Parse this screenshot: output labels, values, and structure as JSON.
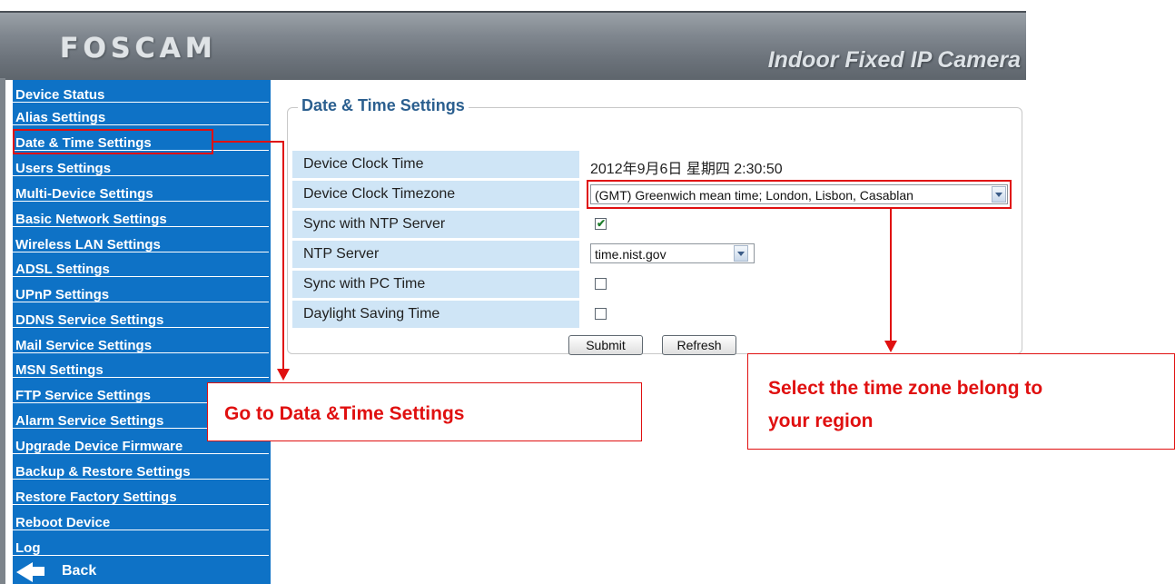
{
  "header": {
    "logo": "FOSCAM",
    "product": "Indoor Fixed IP Camera"
  },
  "sidebar": {
    "items": [
      {
        "label": "Device Status"
      },
      {
        "label": "Alias Settings"
      },
      {
        "label": "Date & Time Settings"
      },
      {
        "label": "Users Settings"
      },
      {
        "label": "Multi-Device Settings"
      },
      {
        "label": "Basic Network Settings"
      },
      {
        "label": "Wireless LAN Settings"
      },
      {
        "label": "ADSL Settings"
      },
      {
        "label": "UPnP Settings"
      },
      {
        "label": "DDNS Service Settings"
      },
      {
        "label": "Mail Service Settings"
      },
      {
        "label": "MSN Settings"
      },
      {
        "label": "FTP Service Settings"
      },
      {
        "label": "Alarm Service Settings"
      },
      {
        "label": "Upgrade Device Firmware"
      },
      {
        "label": "Backup & Restore Settings"
      },
      {
        "label": "Restore Factory Settings"
      },
      {
        "label": "Reboot Device"
      },
      {
        "label": "Log"
      }
    ],
    "back_label": "Back",
    "back_icon": "back-arrow-icon"
  },
  "panel": {
    "title": "Date & Time Settings",
    "rows": {
      "clock_time": {
        "label": "Device Clock Time",
        "value": "2012年9月6日 星期四 2:30:50"
      },
      "timezone": {
        "label": "Device Clock Timezone",
        "value": "(GMT) Greenwich mean time; London, Lisbon, Casablan"
      },
      "sync_ntp": {
        "label": "Sync with NTP Server",
        "checked": true
      },
      "ntp_server": {
        "label": "NTP Server",
        "value": "time.nist.gov"
      },
      "sync_pc": {
        "label": "Sync with PC Time",
        "checked": false
      },
      "dst": {
        "label": "Daylight Saving Time",
        "checked": false
      }
    },
    "submit_label": "Submit",
    "refresh_label": "Refresh"
  },
  "annotations": {
    "left_callout": "Go to Data &Time Settings",
    "right_callout_line1": "Select the time zone belong to",
    "right_callout_line2": "your region"
  },
  "colors": {
    "sidebar": "#0e72c6",
    "label_cell": "#cfe5f6",
    "annotation": "#e01010",
    "panel_title": "#2b5f8f"
  }
}
